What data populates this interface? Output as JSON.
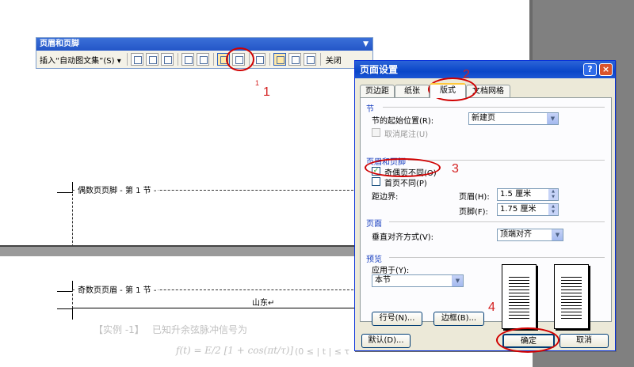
{
  "annotations": {
    "step1_small": "1",
    "step1": "1",
    "step2": "2",
    "step3": "3",
    "step4": "4"
  },
  "document": {
    "even_header_label": "偶数页页脚 - 第 1 节 -",
    "odd_header_label": "奇数页页眉 - 第 1 节 -",
    "header_text": "山东↵",
    "example_label": "【实例 -1】",
    "example_text": "已知升余弦脉冲信号为",
    "formula": "f(t) = E/2 [1 + cos(πt/τ)]",
    "formula_range": "(0 ≤ | t | ≤ τ"
  },
  "toolbar": {
    "title": "页眉和页脚",
    "insert_autotext": "插入“自动图文集”(S) ▾",
    "close_label": "关闭"
  },
  "dialog": {
    "title": "页面设置",
    "help_label": "?",
    "close_label": "×",
    "tabs": [
      "页边距",
      "纸张",
      "版式",
      "文档网格"
    ],
    "section_head": "节",
    "section_start_label": "节的起始位置(R):",
    "section_start_value": "新建页",
    "suppress_endnotes_label": "取消尾注(U)",
    "hf_head": "页眉和页脚",
    "odd_even_label": "奇偶页不同(O)",
    "odd_even_check": "✓",
    "first_page_label": "首页不同(P)",
    "from_edge_label": "距边界:",
    "header_label": "页眉(H):",
    "header_value": "1.5 厘米",
    "footer_label": "页脚(F):",
    "footer_value": "1.75 厘米",
    "page_head": "页面",
    "valign_label": "垂直对齐方式(V):",
    "valign_value": "顶端对齐",
    "preview_head": "预览",
    "apply_to_label": "应用于(Y):",
    "apply_to_value": "本节",
    "line_numbers_button": "行号(N)...",
    "borders_button": "边框(B)...",
    "default_button": "默认(D)...",
    "ok_button": "确定",
    "cancel_button": "取消"
  }
}
